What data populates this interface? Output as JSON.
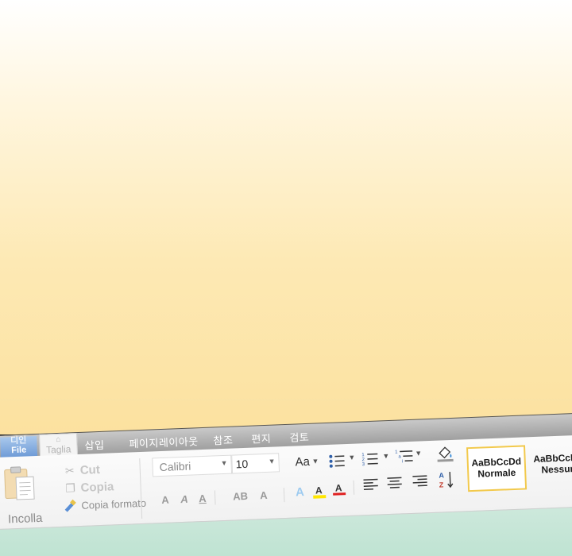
{
  "ribbon": {
    "tabs": {
      "file_top": "디인",
      "file": "File",
      "home_label": "Taglia",
      "insert": "삽입",
      "layout": "페이지레이아웃",
      "references": "참조",
      "mailings": "편지",
      "review": "검토"
    },
    "clipboard": {
      "paste": "Incolla",
      "cut": "Cut",
      "copy": "Copia",
      "format_painter": "Copia formato"
    },
    "font": {
      "name": "Calibri",
      "size": "10",
      "case_label": "Aa",
      "format_a1": "A",
      "format_a2": "A",
      "format_a3": "A",
      "format_ab": "AB",
      "format_a4": "A"
    },
    "styles": {
      "normal_sample": "AaBbCcDd",
      "normal_name": "Normale",
      "nospacing_sample": "AaBbCcDd",
      "nospacing_name": "Nessun"
    }
  },
  "colors": {
    "highlight": "#ffe600",
    "font_color": "#e02020",
    "style_border": "#f2c94c"
  }
}
